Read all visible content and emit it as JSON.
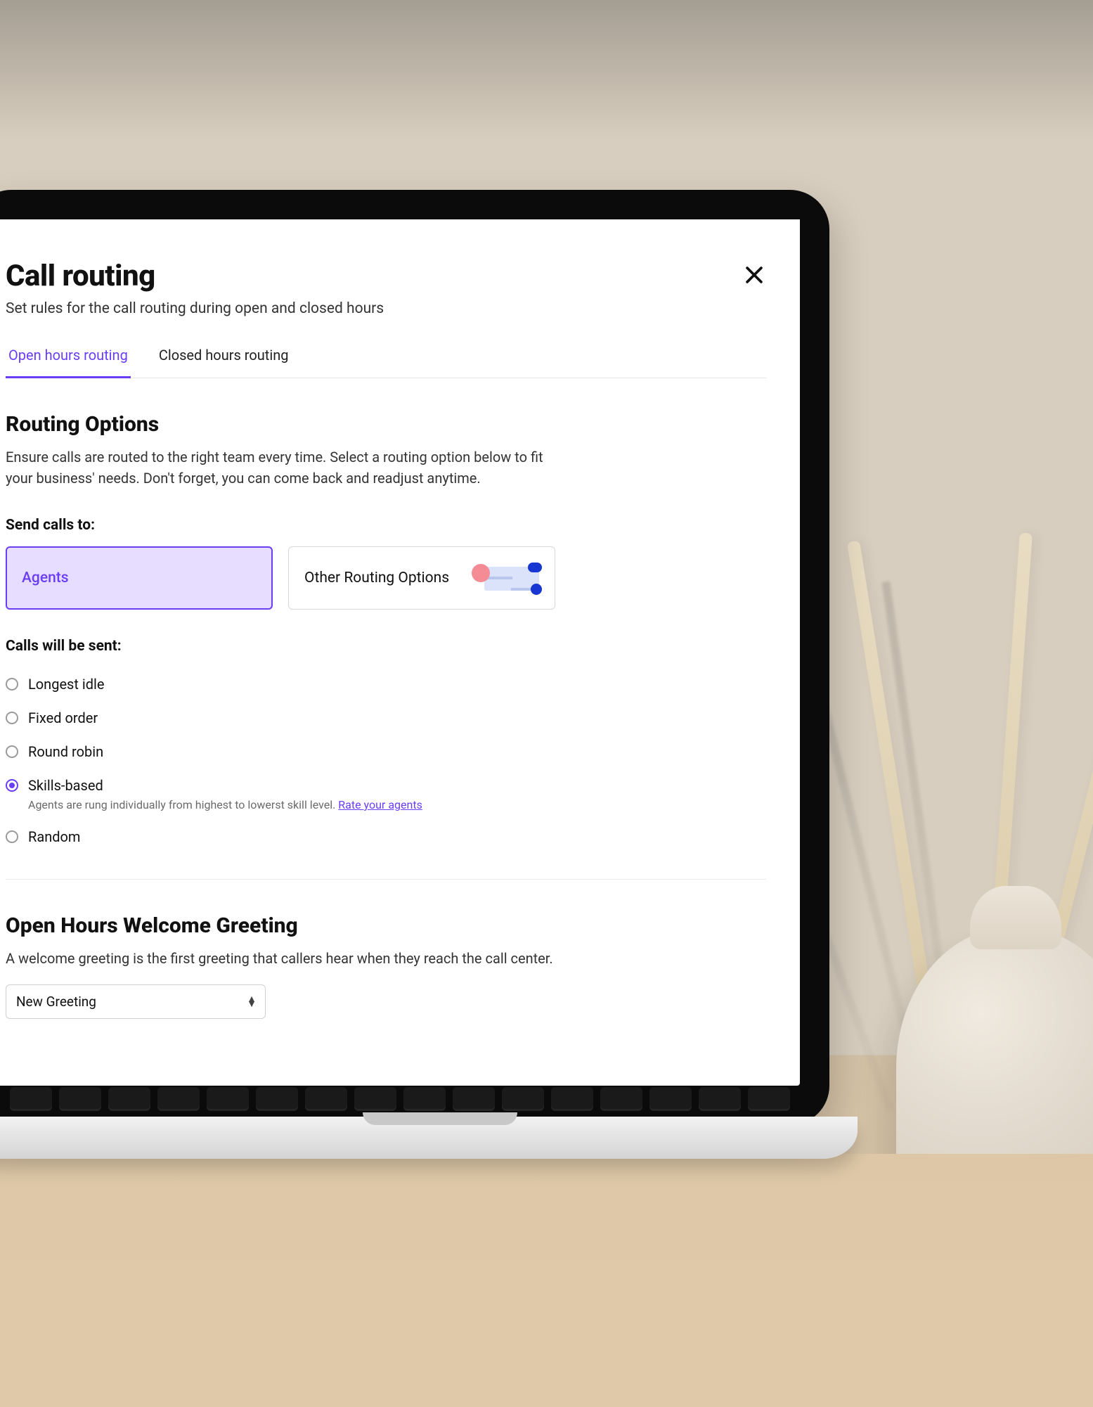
{
  "header": {
    "title": "Call routing",
    "subtitle": "Set rules for the call routing during open and closed hours"
  },
  "tabs": {
    "open": "Open hours routing",
    "closed": "Closed hours routing",
    "active": "open"
  },
  "routing": {
    "title": "Routing Options",
    "description": "Ensure calls are routed to the right team every time. Select a routing option below to fit your business' needs. Don't forget, you can come back and readjust anytime.",
    "send_label": "Send calls to:",
    "cards": {
      "agents": "Agents",
      "other": "Other Routing Options"
    },
    "selected_card": "agents",
    "dist_label": "Calls will be sent:",
    "options": [
      {
        "key": "longest_idle",
        "label": "Longest idle"
      },
      {
        "key": "fixed_order",
        "label": "Fixed order"
      },
      {
        "key": "round_robin",
        "label": "Round robin"
      },
      {
        "key": "skills_based",
        "label": "Skills-based",
        "hint_prefix": "Agents are rung individually from highest to lowerst skill level. ",
        "hint_link": "Rate your agents"
      },
      {
        "key": "random",
        "label": "Random"
      }
    ],
    "selected_option": "skills_based"
  },
  "greeting": {
    "title": "Open Hours Welcome Greeting",
    "description": "A welcome greeting is the first greeting that callers hear when they reach the call center.",
    "select_value": "New Greeting"
  },
  "colors": {
    "accent": "#6b3df5",
    "accent_light": "#e7ddff"
  }
}
